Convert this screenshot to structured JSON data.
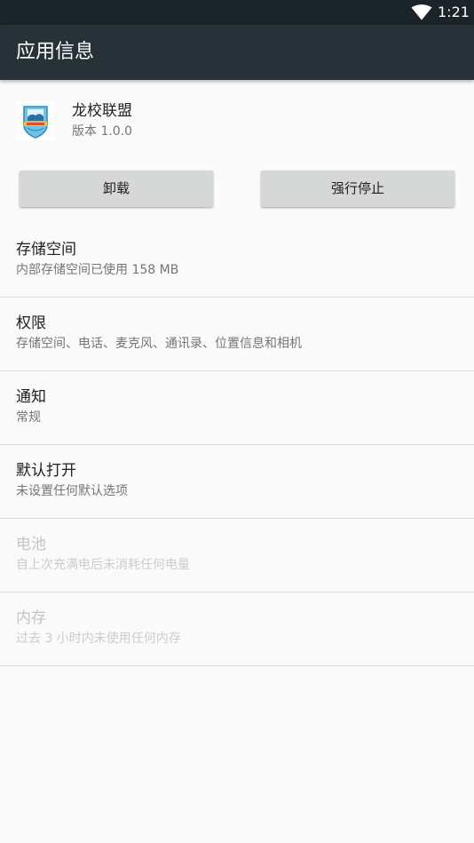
{
  "status_bar": {
    "time": "1:21",
    "wifi_icon": "wifi-icon"
  },
  "app_bar": {
    "title": "应用信息"
  },
  "app": {
    "name": "龙校联盟",
    "version": "版本 1.0.0",
    "icon": "app-logo-icon"
  },
  "buttons": {
    "uninstall": "卸载",
    "force_stop": "强行停止"
  },
  "items": [
    {
      "title": "存储空间",
      "subtitle": "内部存储空间已使用 158 MB",
      "enabled": true
    },
    {
      "title": "权限",
      "subtitle": "存储空间、电话、麦克风、通讯录、位置信息和相机",
      "enabled": true
    },
    {
      "title": "通知",
      "subtitle": "常规",
      "enabled": true
    },
    {
      "title": "默认打开",
      "subtitle": "未设置任何默认选项",
      "enabled": true
    },
    {
      "title": "电池",
      "subtitle": "自上次充满电后未消耗任何电量",
      "enabled": false
    },
    {
      "title": "内存",
      "subtitle": "过去 3 小时内未使用任何内存",
      "enabled": false
    }
  ],
  "colors": {
    "status_bar": "#1b2428",
    "app_bar": "#263238",
    "background": "#fafafa",
    "button": "#d6d7d7",
    "divider": "#dcdcdc"
  }
}
